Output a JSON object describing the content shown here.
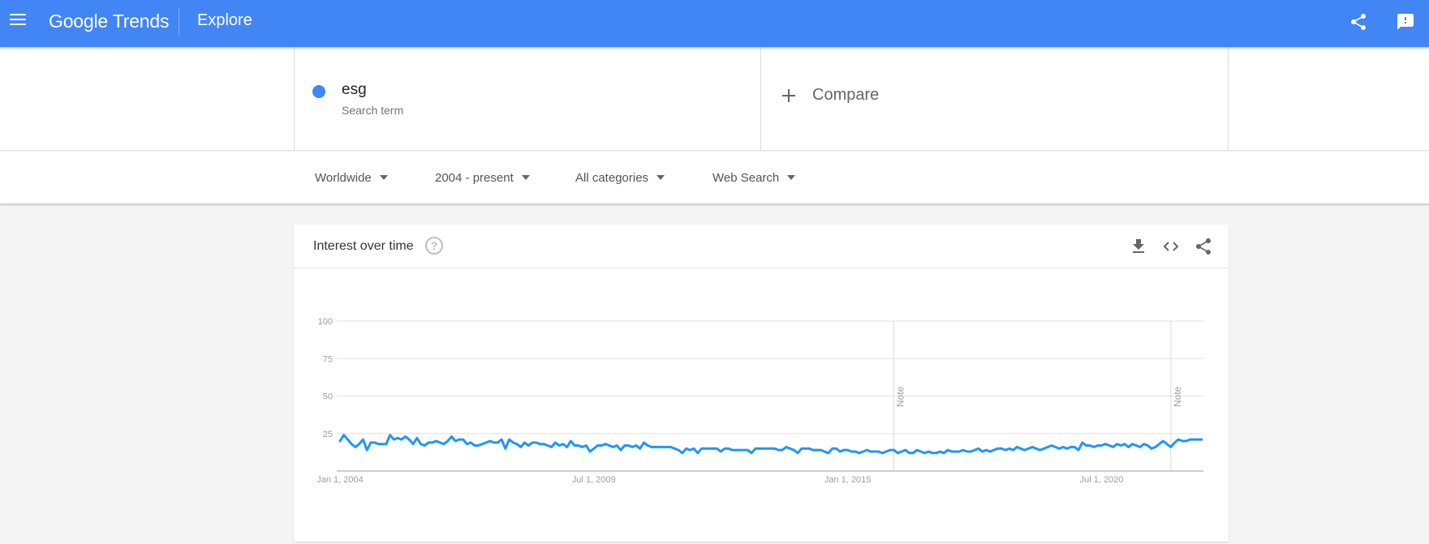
{
  "appbar": {
    "logo_google": "Google",
    "logo_trends": "Trends",
    "section": "Explore",
    "colors": {
      "brand": "#4285f4"
    }
  },
  "search_term": {
    "name": "esg",
    "subtitle": "Search term",
    "color": "#4285f4"
  },
  "compare": {
    "label": "Compare"
  },
  "filters": [
    {
      "label": "Worldwide"
    },
    {
      "label": "2004 - present"
    },
    {
      "label": "All categories"
    },
    {
      "label": "Web Search"
    }
  ],
  "card": {
    "title": "Interest over time",
    "help_icon": "?"
  },
  "chart_data": {
    "type": "line",
    "title": "Interest over time",
    "xlabel": "",
    "ylabel": "",
    "ylim": [
      0,
      100
    ],
    "yticks": [
      25,
      50,
      75,
      100
    ],
    "ytick_labels": [
      "25",
      "50",
      "75",
      "100"
    ],
    "xticks": [
      {
        "label": "Jan 1, 2004",
        "month_index": 0
      },
      {
        "label": "Jul 1, 2009",
        "month_index": 66
      },
      {
        "label": "Jan 1, 2015",
        "month_index": 132
      },
      {
        "label": "Jul 1, 2020",
        "month_index": 198
      }
    ],
    "x_start": "2004-01",
    "x_interval": "monthly",
    "grid": true,
    "annotations": [
      {
        "label": "Note",
        "month_index": 144
      },
      {
        "label": "Note",
        "month_index": 216
      }
    ],
    "series": [
      {
        "name": "esg",
        "color": "#2196f3",
        "values": [
          20,
          24,
          21,
          18,
          16,
          18,
          21,
          14,
          19,
          19,
          18,
          18,
          18,
          24,
          21,
          22,
          21,
          23,
          21,
          18,
          22,
          18,
          17,
          19,
          19,
          20,
          19,
          18,
          20,
          23,
          20,
          21,
          21,
          18,
          19,
          17,
          17,
          18,
          19,
          20,
          19,
          19,
          21,
          15,
          21,
          19,
          18,
          16,
          19,
          17,
          19,
          19,
          18,
          18,
          17,
          16,
          19,
          17,
          18,
          16,
          20,
          17,
          17,
          16,
          17,
          13,
          15,
          17,
          17,
          18,
          17,
          16,
          17,
          14,
          17,
          17,
          16,
          17,
          15,
          19,
          17,
          16,
          16,
          16,
          16,
          16,
          16,
          15,
          14,
          12,
          15,
          14,
          15,
          12,
          15,
          15,
          15,
          15,
          15,
          13,
          15,
          15,
          14,
          14,
          14,
          14,
          14,
          12,
          15,
          15,
          15,
          15,
          15,
          15,
          14,
          14,
          16,
          15,
          14,
          12,
          15,
          15,
          15,
          14,
          14,
          14,
          13,
          12,
          15,
          15,
          13,
          14,
          14,
          13,
          13,
          12,
          13,
          14,
          13,
          13,
          13,
          12,
          13,
          14,
          14,
          12,
          13,
          14,
          12,
          12,
          14,
          13,
          12,
          13,
          12,
          12,
          13,
          12,
          14,
          13,
          13,
          13,
          14,
          13,
          13,
          14,
          15,
          13,
          14,
          13,
          14,
          15,
          15,
          14,
          15,
          14,
          16,
          15,
          14,
          15,
          16,
          15,
          14,
          15,
          16,
          17,
          16,
          15,
          16,
          15,
          16,
          16,
          14,
          19,
          17,
          17,
          16,
          17,
          17,
          18,
          17,
          16,
          18,
          17,
          18,
          16,
          18,
          17,
          16,
          18,
          17,
          15,
          16,
          18,
          20,
          18,
          16,
          19,
          21,
          20,
          20,
          21,
          21,
          21,
          21
        ]
      }
    ]
  }
}
